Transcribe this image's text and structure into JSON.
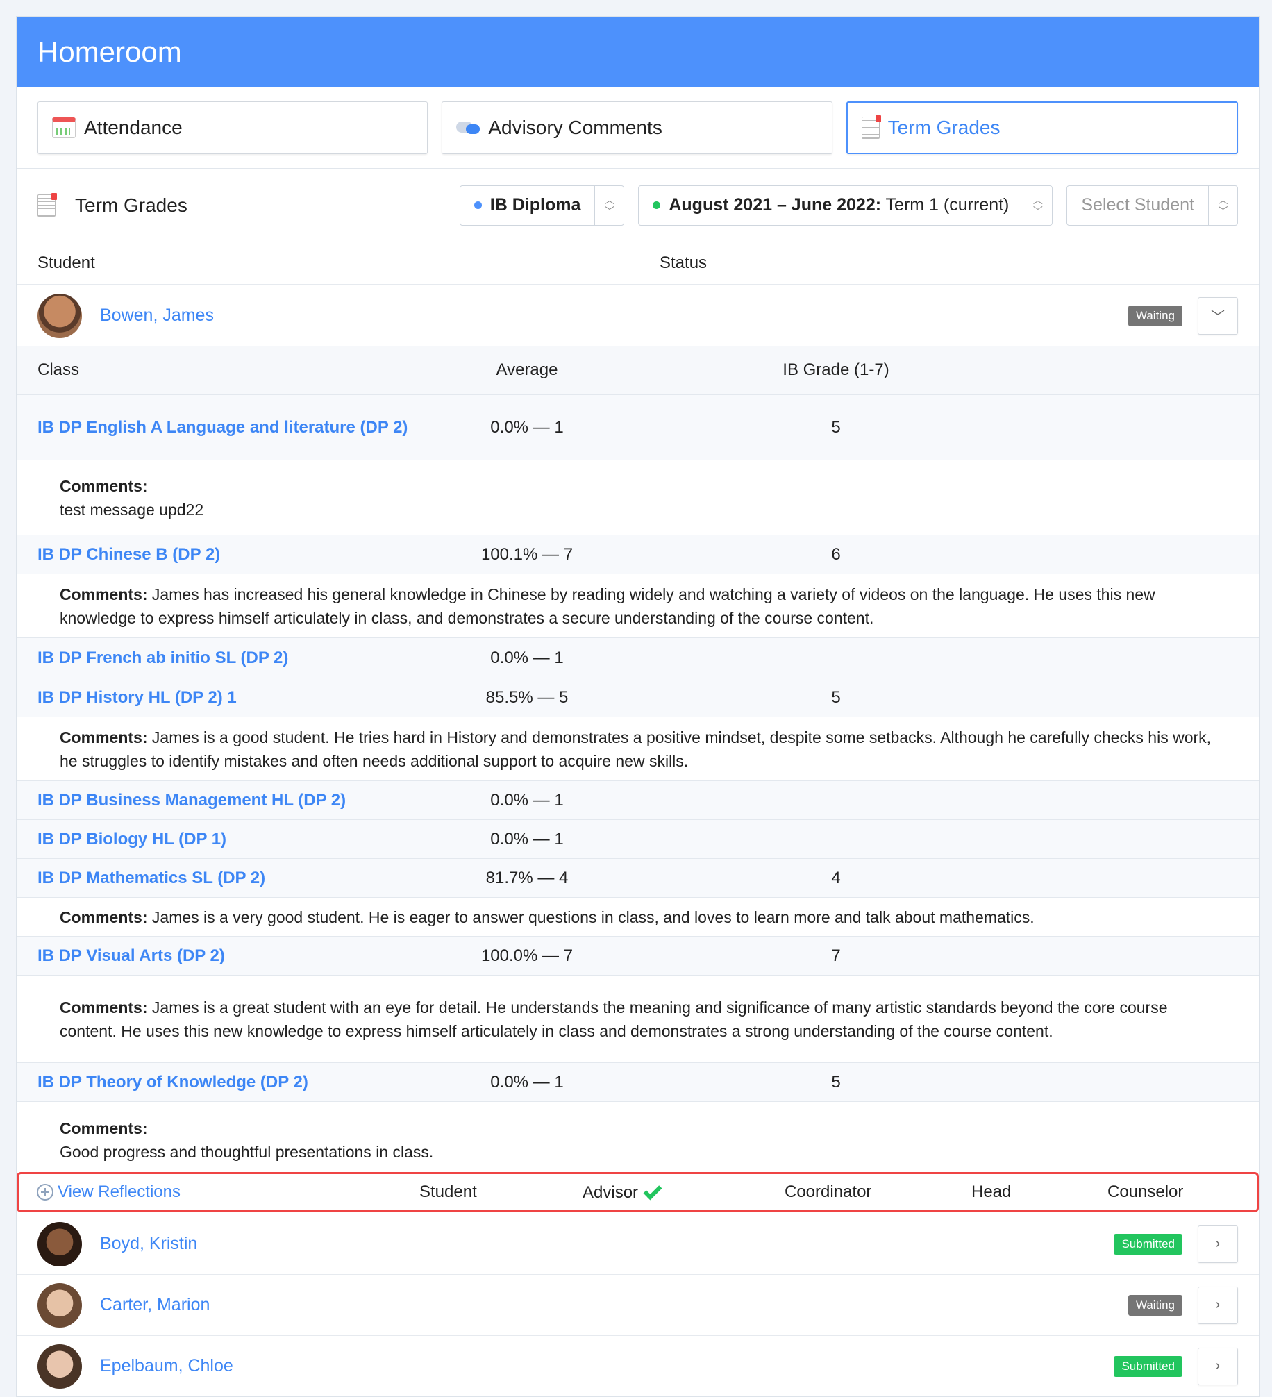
{
  "header": {
    "title": "Homeroom"
  },
  "tabs": [
    {
      "label": "Attendance",
      "icon": "calendar-icon",
      "active": false
    },
    {
      "label": "Advisory Comments",
      "icon": "chat-icon",
      "active": true
    },
    {
      "label": "Term Grades",
      "icon": "report-icon",
      "active": true
    }
  ],
  "toolbar": {
    "title": "Term Grades",
    "program": {
      "label": "IB Diploma",
      "dot_color": "#4d91fc"
    },
    "term": {
      "bold": "August 2021 – June 2022:",
      "rest": " Term 1 (current)",
      "dot_color": "#22c55e"
    },
    "student_select": {
      "placeholder": "Select Student"
    }
  },
  "table": {
    "student_col": "Student",
    "status_col": "Status"
  },
  "expanded_student": {
    "name": "Bowen, James",
    "status": "Waiting"
  },
  "class_table": {
    "headers": {
      "class": "Class",
      "average": "Average",
      "grade": "IB Grade (1-7)"
    },
    "rows": [
      {
        "class": "IB DP English A Language and literature (DP 2)",
        "average": "0.0% — 1",
        "grade": "5",
        "comment_label": "Comments:",
        "comment": "test message upd22",
        "comment_block": true
      },
      {
        "class": "IB DP Chinese B (DP 2)",
        "average": "100.1% — 7",
        "grade": "6",
        "comment_label": "Comments:",
        "comment": " James has increased his general knowledge in Chinese by reading widely and watching a variety of videos on the language. He uses this new knowledge to express himself articulately in class, and demonstrates a secure understanding of the course content."
      },
      {
        "class": "IB DP French ab initio SL (DP 2)",
        "average": "0.0% — 1",
        "grade": ""
      },
      {
        "class": "IB DP History HL (DP 2) 1",
        "average": "85.5% — 5",
        "grade": "5",
        "comment_label": "Comments:",
        "comment": " James is a good student. He tries hard in History and demonstrates a positive mindset, despite some setbacks. Although he carefully checks his work, he struggles to identify mistakes and often needs additional support to acquire new skills."
      },
      {
        "class": "IB DP Business Management HL (DP 2)",
        "average": "0.0% — 1",
        "grade": ""
      },
      {
        "class": "IB DP Biology HL (DP 1)",
        "average": "0.0% — 1",
        "grade": ""
      },
      {
        "class": "IB DP Mathematics SL (DP 2)",
        "average": "81.7% — 4",
        "grade": "4",
        "comment_label": "Comments:",
        "comment": " James is a very good student. He is eager to answer questions in class, and loves to learn more and talk about mathematics."
      },
      {
        "class": "IB DP Visual Arts (DP 2)",
        "average": "100.0% — 7",
        "grade": "7",
        "comment_label": "Comments:",
        "comment": " James is a great student with an eye for detail. He understands the meaning and significance of many artistic standards beyond the core course content. He uses this new knowledge to express himself articulately in class and demonstrates a strong understanding of the course content."
      },
      {
        "class": "IB DP Theory of Knowledge (DP 2)",
        "average": "0.0% — 1",
        "grade": "5",
        "comment_label": "Comments:",
        "comment": "Good progress and thoughtful presentations in class.",
        "comment_block": true
      }
    ]
  },
  "reflections": {
    "link": "View Reflections",
    "student": "Student",
    "advisor": "Advisor",
    "coordinator": "Coordinator",
    "head": "Head",
    "counselor": "Counselor"
  },
  "other_students": [
    {
      "name": "Boyd, Kristin",
      "status": "Submitted"
    },
    {
      "name": "Carter, Marion",
      "status": "Waiting"
    },
    {
      "name": "Epelbaum, Chloe",
      "status": "Submitted"
    }
  ]
}
